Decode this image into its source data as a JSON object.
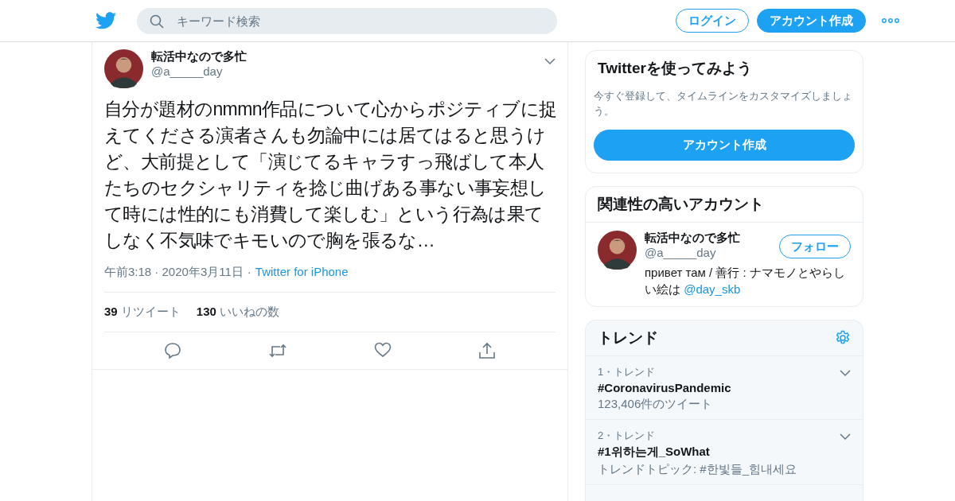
{
  "header": {
    "search": {
      "placeholder": "キーワード検索"
    },
    "login": "ログイン",
    "signup": "アカウント作成"
  },
  "tweet": {
    "name": "転活中なので多忙",
    "handle": "@a_____day",
    "text": "自分が題材のnmmn作品について心からポジティブに捉えてくださる演者さんも勿論中には居てはると思うけど、大前提として「演じてるキャラすっ飛ばして本人たちのセクシャリティを捻じ曲げある事ない事妄想して時には性的にも消費して楽しむ」という行為は果てしなく不気味でキモいので胸を張るな…",
    "time": "午前3:18 · 2020年3月11日",
    "sep": "·",
    "source": "Twitter for iPhone",
    "retweets": "39",
    "retweets_label": "リツイート",
    "likes": "130",
    "likes_label": "いいねの数"
  },
  "signup_card": {
    "title": "Twitterを使ってみよう",
    "text": "今すぐ登録して、タイムラインをカスタマイズしましょう。",
    "button": "アカウント作成"
  },
  "related": {
    "title": "関連性の高いアカウント",
    "accounts": [
      {
        "name": "転活中なので多忙",
        "handle": "@a_____day",
        "follow": "フォロー",
        "bio": "привет там / 善行 : ナマモノとやらしい絵は ",
        "link": "@day_skb"
      }
    ]
  },
  "trends": {
    "title": "トレンド",
    "items": [
      {
        "rank": "1・トレンド",
        "name": "#CoronavirusPandemic",
        "meta": "123,406件のツイート"
      },
      {
        "rank": "2・トレンド",
        "name": "#1위하는게_SoWhat",
        "meta": "トレンドトピック: #한빛들_힘내세요"
      }
    ]
  }
}
